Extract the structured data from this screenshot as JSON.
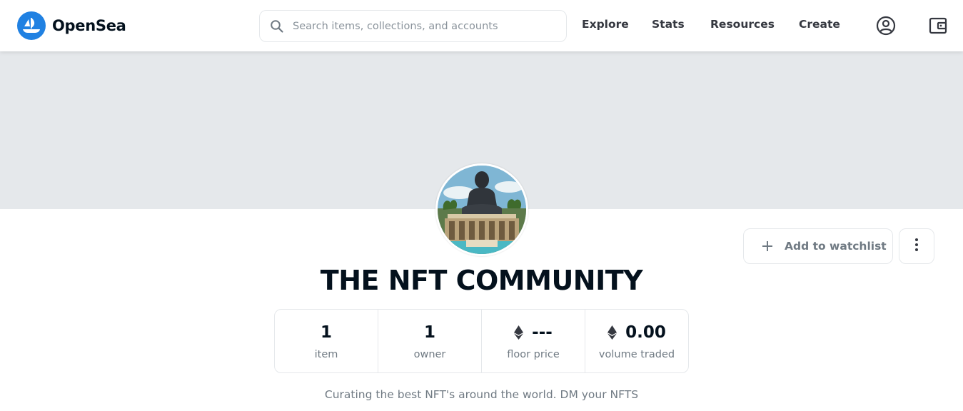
{
  "header": {
    "brand": "OpenSea",
    "search": {
      "placeholder": "Search items, collections, and accounts"
    },
    "nav": {
      "explore": "Explore",
      "stats": "Stats",
      "resources": "Resources",
      "create": "Create"
    },
    "icons": {
      "profile": "user-circle-icon",
      "wallet": "wallet-icon"
    }
  },
  "collection": {
    "title": "THE NFT COMMUNITY",
    "watchlist_label": "Add to watchlist",
    "stats": [
      {
        "value": "1",
        "label": "item",
        "eth": false
      },
      {
        "value": "1",
        "label": "owner",
        "eth": false
      },
      {
        "value": "---",
        "label": "floor price",
        "eth": true
      },
      {
        "value": "0.00",
        "label": "volume traded",
        "eth": true
      }
    ],
    "description": "Curating the best NFT's around the world. DM your NFTS"
  },
  "colors": {
    "accent": "#2081e2",
    "text": "#04111d",
    "muted": "#707a83",
    "border": "#e5e8eb",
    "banner": "#e5e8eb"
  }
}
